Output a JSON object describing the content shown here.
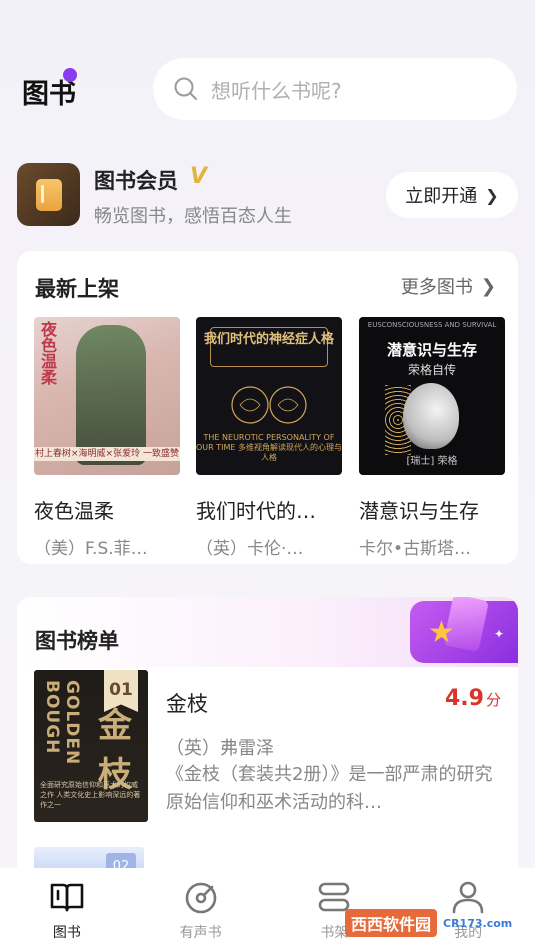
{
  "header": {
    "title": "图书",
    "search_placeholder": "想听什么书呢?",
    "search_icon": "search-icon"
  },
  "member": {
    "name": "图书会员",
    "vip_mark": "V",
    "subtitle": "畅览图书，感悟百态人生",
    "button_label": "立即开通"
  },
  "newest": {
    "title": "最新上架",
    "more_label": "更多图书",
    "books": [
      {
        "title": "夜色温柔",
        "author": "（美）F.S.菲…",
        "cover_title": "夜色温柔",
        "cover_band": "村上春树×海明威×张爱玲 一致盛赞"
      },
      {
        "title": "我们时代的…",
        "author": "（英）卡伦·…",
        "cover_title": "我们时代的神经症人格",
        "cover_sub": "THE NEUROTIC PERSONALITY OF OUR TIME 多维视角解读现代人的心理与人格"
      },
      {
        "title": "潜意识与生存",
        "author": "卡尔•古斯塔…",
        "cover_top": "EUSCONSCIOUSNESS AND SURVIVAL",
        "cover_title": "潜意识与生存",
        "cover_sub": "荣格自传",
        "cover_bottom": "[瑞士] 荣格"
      }
    ]
  },
  "ranking": {
    "title": "图书榜单",
    "items": [
      {
        "rank": "01",
        "name": "金枝",
        "score": "4.9",
        "score_unit": "分",
        "author": "（英）弗雷泽",
        "description": "《金枝（套装共2册）》是一部严肃的研究原始信仰和巫术活动的科…",
        "cover_en": "GOLDEN BOUGH",
        "cover_zh": "金枝",
        "cover_lines": "全面研究原始信仰和巫术的权威之作 人类文化史上影响深远的著作之一"
      },
      {
        "rank": "02"
      }
    ]
  },
  "tabbar": {
    "tabs": [
      {
        "label": "图书",
        "icon": "book-icon",
        "active": true
      },
      {
        "label": "有声书",
        "icon": "audio-disc-icon",
        "active": false
      },
      {
        "label": "书架",
        "icon": "bookshelf-icon",
        "active": false
      },
      {
        "label": "我的",
        "icon": "profile-icon",
        "active": false
      }
    ]
  },
  "watermark": {
    "brand": "西西软件园",
    "url": "CR173.com"
  },
  "colors": {
    "accent_purple": "#8a3cf0",
    "score_red": "#d8342c",
    "vip_gold": "#e4b33c"
  }
}
